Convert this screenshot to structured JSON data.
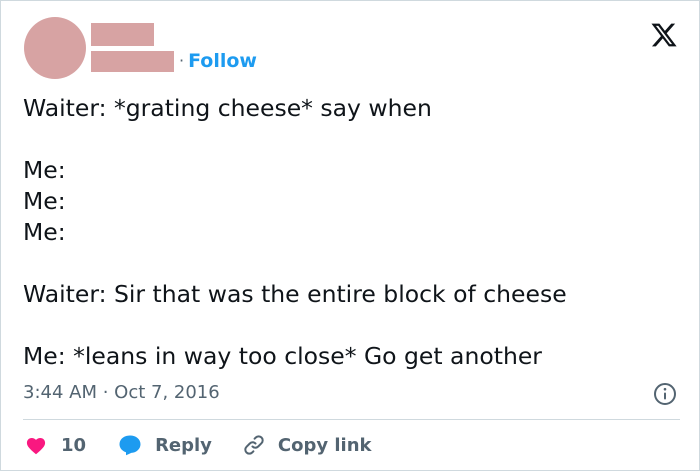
{
  "header": {
    "follow_separator": "·",
    "follow_label": "Follow"
  },
  "tweet": {
    "lines": [
      "Waiter: *grating cheese* say when",
      "",
      "Me:",
      "Me:",
      "Me:",
      "",
      "Waiter: Sir that was the entire block of cheese",
      "",
      "Me: *leans in way too close* Go get another"
    ],
    "timestamp": "3:44 AM · Oct 7, 2016"
  },
  "actions": {
    "like_count": "10",
    "reply_label": "Reply",
    "copy_label": "Copy link"
  },
  "icons": {
    "logo": "x-logo-icon",
    "info": "info-icon",
    "like": "heart-icon",
    "reply": "speech-bubble-icon",
    "copy": "link-icon"
  },
  "colors": {
    "accent": "#1d9bf0",
    "like": "#f91880",
    "placeholder": "#d7a3a3",
    "muted": "#536471"
  }
}
